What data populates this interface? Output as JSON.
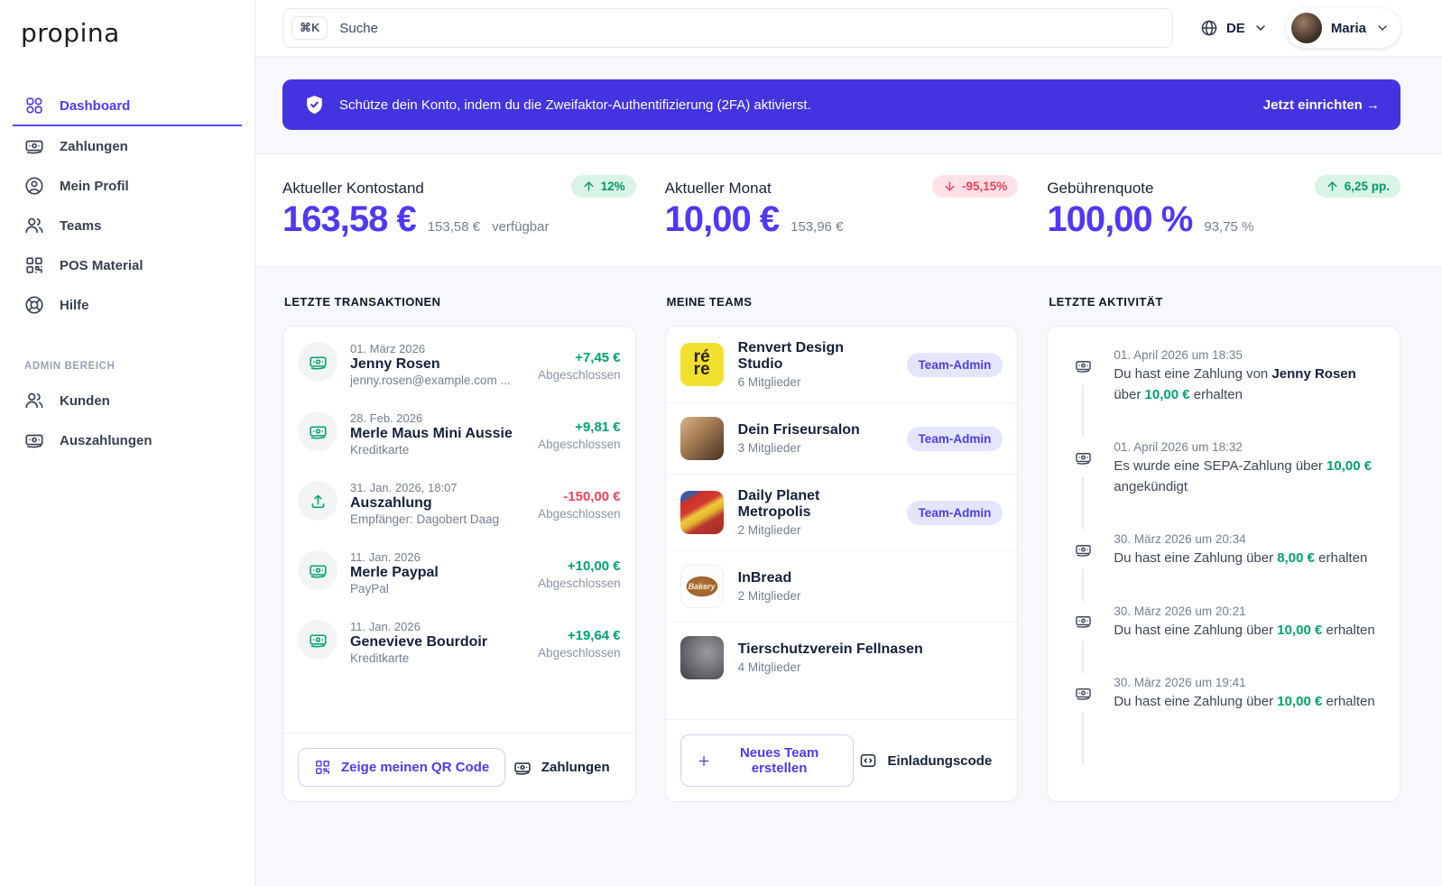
{
  "brand": {
    "logo": "propina"
  },
  "topbar": {
    "search_shortcut": "⌘K",
    "search_placeholder": "Suche",
    "language": "DE",
    "user_name": "Maria"
  },
  "banner": {
    "text": "Schütze dein Konto, indem du die Zweifaktor-Authentifizierung (2FA) aktivierst.",
    "cta": "Jetzt einrichten →"
  },
  "sidebar": {
    "items": [
      {
        "label": "Dashboard",
        "icon": "grid",
        "active": true
      },
      {
        "label": "Zahlungen",
        "icon": "banknote",
        "active": false
      },
      {
        "label": "Mein Profil",
        "icon": "user-circle",
        "active": false
      },
      {
        "label": "Teams",
        "icon": "users",
        "active": false
      },
      {
        "label": "POS Material",
        "icon": "qr-code",
        "active": false
      },
      {
        "label": "Hilfe",
        "icon": "life-buoy",
        "active": false
      }
    ],
    "admin_label": "ADMIN BEREICH",
    "admin_items": [
      {
        "label": "Kunden",
        "icon": "users",
        "active": false
      },
      {
        "label": "Auszahlungen",
        "icon": "banknote",
        "active": false
      }
    ]
  },
  "stats": [
    {
      "label": "Aktueller Kontostand",
      "value": "163,58 €",
      "sub": "153,58 €",
      "sub_note": "verfügbar",
      "badge": "12%",
      "badge_dir": "up"
    },
    {
      "label": "Aktueller Monat",
      "value": "10,00 €",
      "sub": "153,96 €",
      "sub_note": "",
      "badge": "-95,15%",
      "badge_dir": "down"
    },
    {
      "label": "Gebührenquote",
      "value": "100,00 %",
      "sub": "93,75 %",
      "sub_note": "",
      "badge": "6,25 pp.",
      "badge_dir": "up"
    }
  ],
  "transactions": {
    "heading": "LETZTE TRANSAKTIONEN",
    "items": [
      {
        "date": "01. März 2026",
        "name": "Jenny Rosen",
        "sub": "jenny.rosen@example.com ...",
        "amount": "+7,45 €",
        "direction": "positive",
        "status": "Abgeschlossen",
        "icon": "banknote"
      },
      {
        "date": "28. Feb. 2026",
        "name": "Merle Maus Mini Aussie",
        "sub": "Kreditkarte",
        "amount": "+9,81 €",
        "direction": "positive",
        "status": "Abgeschlossen",
        "icon": "banknote"
      },
      {
        "date": "31. Jan. 2026, 18:07",
        "name": "Auszahlung",
        "sub": "Empfänger: Dagobert Daag",
        "amount": "-150,00 €",
        "direction": "negative",
        "status": "Abgeschlossen",
        "icon": "upload"
      },
      {
        "date": "11. Jan. 2026",
        "name": "Merle Paypal",
        "sub": "PayPal",
        "amount": "+10,00 €",
        "direction": "positive",
        "status": "Abgeschlossen",
        "icon": "banknote"
      },
      {
        "date": "11. Jan. 2026",
        "name": "Genevieve Bourdoir",
        "sub": "Kreditkarte",
        "amount": "+19,64 €",
        "direction": "positive",
        "status": "Abgeschlossen",
        "icon": "banknote"
      }
    ],
    "qr_button": "Zeige meinen QR Code",
    "payments_button": "Zahlungen"
  },
  "teams": {
    "heading": "MEINE TEAMS",
    "items": [
      {
        "name": "Renvert Design Studio",
        "members": "6 Mitglieder",
        "badge": "Team-Admin",
        "avatar": "renvert",
        "avatar_text": [
          "ré",
          "re"
        ]
      },
      {
        "name": "Dein Friseursalon",
        "members": "3 Mitglieder",
        "badge": "Team-Admin",
        "avatar": "salon"
      },
      {
        "name": "Daily Planet Metropolis",
        "members": "2 Mitglieder",
        "badge": "Team-Admin",
        "avatar": "daily"
      },
      {
        "name": "InBread",
        "members": "2 Mitglieder",
        "badge": null,
        "avatar": "inbread",
        "avatar_text": "Bakery"
      },
      {
        "name": "Tierschutzverein Fellnasen",
        "members": "4 Mitglieder",
        "badge": null,
        "avatar": "cat"
      }
    ],
    "create_button": "Neues Team erstellen",
    "invite_button": "Einladungscode"
  },
  "activity": {
    "heading": "LETZTE AKTIVITÄT",
    "items": [
      {
        "date": "01. April 2026 um 18:35",
        "segments": [
          {
            "text": "Du hast eine Zahlung von ",
            "style": "plain"
          },
          {
            "text": "Jenny Rosen",
            "style": "bold"
          },
          {
            "text": " über ",
            "style": "plain"
          },
          {
            "text": "10,00 €",
            "style": "amount"
          },
          {
            "text": " erhalten",
            "style": "plain"
          }
        ]
      },
      {
        "date": "01. April 2026 um 18:32",
        "segments": [
          {
            "text": "Es wurde eine SEPA-Zahlung über ",
            "style": "plain"
          },
          {
            "text": "10,00 €",
            "style": "amount"
          },
          {
            "text": " angekündigt",
            "style": "plain"
          }
        ]
      },
      {
        "date": "30. März 2026 um 20:34",
        "segments": [
          {
            "text": "Du hast eine Zahlung über ",
            "style": "plain"
          },
          {
            "text": "8,00 €",
            "style": "amount"
          },
          {
            "text": " erhalten",
            "style": "plain"
          }
        ]
      },
      {
        "date": "30. März 2026 um 20:21",
        "segments": [
          {
            "text": "Du hast eine Zahlung über ",
            "style": "plain"
          },
          {
            "text": "10,00 €",
            "style": "amount"
          },
          {
            "text": " erhalten",
            "style": "plain"
          }
        ]
      },
      {
        "date": "30. März 2026 um 19:41",
        "segments": [
          {
            "text": "Du hast eine Zahlung über ",
            "style": "plain"
          },
          {
            "text": "10,00 €",
            "style": "amount"
          },
          {
            "text": " erhalten",
            "style": "plain"
          }
        ]
      }
    ]
  },
  "colors": {
    "accent": "#4f39f6",
    "banner": "#4433e0",
    "positive": "#00a36e",
    "negative": "#f43f5e",
    "badge_bg": "#e3e6fd"
  }
}
